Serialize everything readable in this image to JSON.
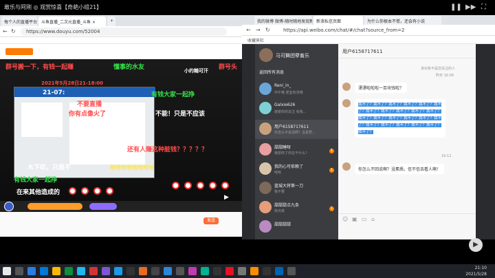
{
  "stream_title": "敢乐与阿刚 ◎ 观赏惊喜【奇葩小组21】",
  "left_browser": {
    "tabs": [
      "每个人的直播平台",
      "斗鱼直播_二次元直播_斗鱼 ×",
      "+"
    ],
    "url": "https://www.douyu.com/52004",
    "danmu": [
      {
        "text": "群号搬一下，有钱一起赚",
        "color": "danmu-r"
      },
      {
        "text": "懂事的水友",
        "color": "danmu-g"
      },
      {
        "text": "小约翰可汗",
        "color": "danmu-w"
      },
      {
        "text": "群号头",
        "color": "danmu-r"
      },
      {
        "text": "2021年5月28日21-18:00",
        "color": "danmu-r"
      },
      {
        "text": "21-07:",
        "color": "danmu-w"
      },
      {
        "text": "有钱大家一起挣",
        "color": "danmu-g"
      },
      {
        "text": "不要直播",
        "color": "danmu-r"
      },
      {
        "text": "你有点像火了",
        "color": "danmu-r"
      },
      {
        "text": "？",
        "color": "danmu-w"
      },
      {
        "text": "不能！只是不应该",
        "color": "danmu-w"
      },
      {
        "text": "还有人赚这种脏钱？？？？？",
        "color": "danmu-r"
      },
      {
        "text": "哈哈哈哈哈哈哈哈",
        "color": "danmu-y"
      },
      {
        "text": "木下叹，只是不",
        "color": "danmu-w"
      },
      {
        "text": "有钱大家一起挣",
        "color": "danmu-g"
      },
      {
        "text": "在来其他造成的",
        "color": "danmu-w"
      }
    ],
    "send_label": "发送"
  },
  "right_browser": {
    "tabs": [
      "我的微博 微博-随时随地发现新鲜事",
      "新浪私信页面",
      "为什么你根本不慌，还会有小说"
    ],
    "url": "https://api.weibo.com/chat/#/chat?source_from=2",
    "bookmark": "收藏夹栏",
    "profile_name": "马可舞团孽畜乐",
    "back_label": "返回所有消息",
    "conversations": [
      {
        "name": "Reni_in_",
        "preview": "中午哦 便宜有货哦",
        "time": "",
        "badge": ""
      },
      {
        "name": "Galxie626",
        "preview": "谢谢你的关注 有我…",
        "time": "",
        "badge": ""
      },
      {
        "name": "用户6158717611",
        "preview": "你怎么不说话啊？没素质…",
        "time": "",
        "badge": ""
      },
      {
        "name": "甜甜睡呀",
        "preview": "我想你了你在干什么？",
        "time": "",
        "badge": "1"
      },
      {
        "name": "我的心可依赖了",
        "preview": "哈哈",
        "time": "",
        "badge": "1"
      },
      {
        "name": "蓝城大将第一刀",
        "preview": "我不要",
        "time": "",
        "badge": ""
      },
      {
        "name": "甜甜甜点九条",
        "preview": "快点来",
        "time": "",
        "badge": "1"
      },
      {
        "name": "甜甜甜甜",
        "preview": "",
        "time": "",
        "badge": ""
      }
    ],
    "chat_header": "用户6158717611",
    "system_note": "该对象不是您关注的人",
    "time1": "昨天 16:06",
    "msg1": "漂漂啦啦啦一百块钱啦？",
    "selected_text": "我不了？我不了？我不了？我不了？我不了？我不了？我不了？我不了？我不了？我不了？我不了？我不了？我不了？我不了？我不了？我不了？我不了？我不了？我不了？我不了？我不了？我不了？我不了？",
    "time2": "16:12",
    "msg2": "你怎么不回说啊？没素质。信不信去看人啊！"
  },
  "taskbar": {
    "time": "21:10",
    "date": "2021/5/28"
  }
}
